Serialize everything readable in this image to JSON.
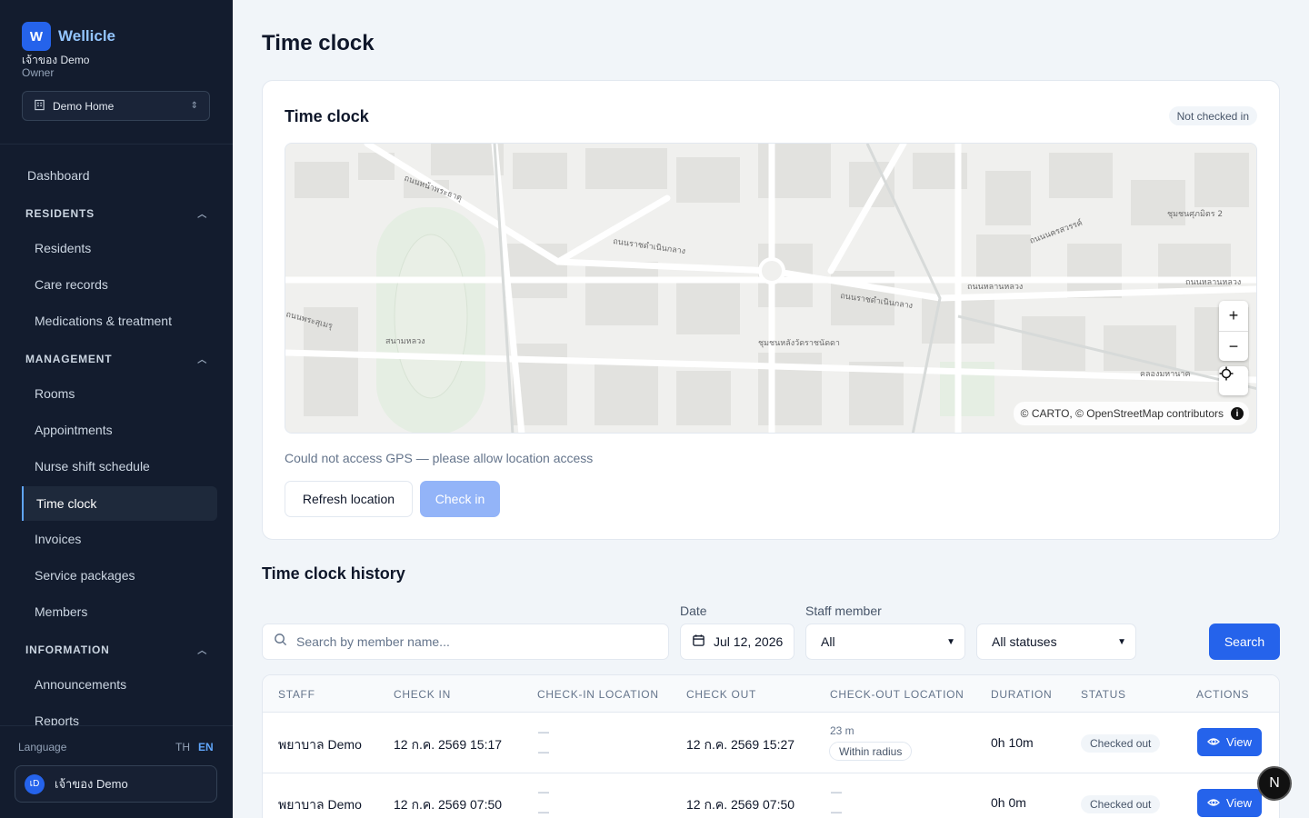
{
  "brand": {
    "logo_letter": "W",
    "name": "Wellicle",
    "user_name": "เจ้าของ Demo",
    "user_role": "Owner",
    "branch": "Demo Home"
  },
  "nav": {
    "dashboard": "Dashboard",
    "residents_section": "RESIDENTS",
    "residents": "Residents",
    "care_records": "Care records",
    "medications": "Medications & treatment",
    "management_section": "MANAGEMENT",
    "rooms": "Rooms",
    "appointments": "Appointments",
    "nurse_shift": "Nurse shift schedule",
    "time_clock": "Time clock",
    "invoices": "Invoices",
    "service_packages": "Service packages",
    "members": "Members",
    "information_section": "INFORMATION",
    "announcements": "Announcements",
    "reports": "Reports"
  },
  "language": {
    "label": "Language",
    "th": "TH",
    "en": "EN"
  },
  "user_chip": {
    "initials": "เD",
    "name": "เจ้าของ Demo"
  },
  "page_title": "Time clock",
  "clock_card": {
    "title": "Time clock",
    "status": "Not checked in",
    "attribution": "© CARTO, © OpenStreetMap contributors",
    "zoom_in": "+",
    "zoom_out": "−",
    "gps_message": "Could not access GPS — please allow location access",
    "refresh_label": "Refresh location",
    "checkin_label": "Check in"
  },
  "map_labels": {
    "road1": "ถนนราชดำเนินกลาง",
    "road2": "ถนนราชดำเนินกลาง",
    "road3": "ถนนหลานหลวง",
    "road4": "ถนนพระสุเมรุ",
    "road5": "ชุมชนหลังวัดราชนัดดา",
    "road6": "คลองมหานาค",
    "road7": "สนามหลวง",
    "road8": "ถนนหน้าพระธาตุ",
    "road9": "ชุมชนศุภมิตร 2",
    "road10": "ถนนหลานหลวง",
    "road11": "ถนนนครสวรรค์"
  },
  "history": {
    "title": "Time clock history",
    "search_placeholder": "Search by member name...",
    "date_label": "Date",
    "date_value": "Jul 12, 2026",
    "staff_label": "Staff member",
    "staff_value": "All",
    "status_value": "All statuses",
    "search_button": "Search",
    "columns": [
      "STAFF",
      "CHECK IN",
      "CHECK-IN LOCATION",
      "CHECK OUT",
      "CHECK-OUT LOCATION",
      "DURATION",
      "STATUS",
      "ACTIONS"
    ],
    "rows": [
      {
        "staff": "พยาบาล Demo",
        "check_in": "12 ก.ค. 2569 15:17",
        "in_loc_1": "—",
        "in_loc_2": "—",
        "check_out": "12 ก.ค. 2569 15:27",
        "distance": "23 m",
        "radius": "Within radius",
        "duration": "0h 10m",
        "status": "Checked out",
        "action": "View"
      },
      {
        "staff": "พยาบาล Demo",
        "check_in": "12 ก.ค. 2569 07:50",
        "in_loc_1": "—",
        "in_loc_2": "—",
        "check_out": "12 ก.ค. 2569 07:50",
        "out_loc_1": "—",
        "out_loc_2": "—",
        "duration": "0h 0m",
        "status": "Checked out",
        "action": "View"
      }
    ]
  },
  "dev_badge": "N",
  "colors": {
    "sidebar_bg": "#131c2e",
    "accent": "#2563eb",
    "page_bg": "#f1f5f9"
  }
}
